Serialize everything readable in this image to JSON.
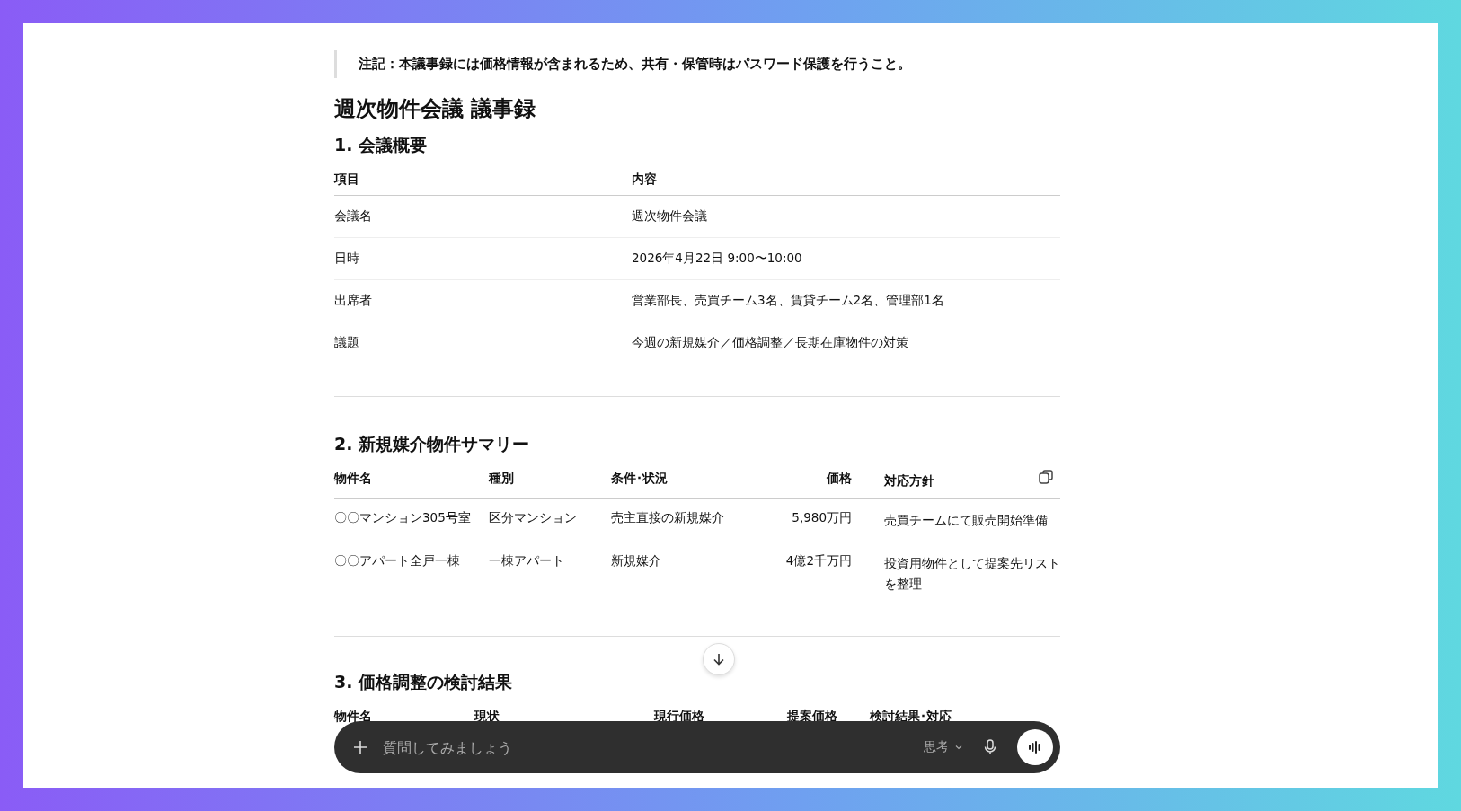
{
  "note": "注記：本議事録には価格情報が含まれるため、共有・保管時はパスワード保護を行うこと。",
  "title": "週次物件会議 議事録",
  "overview": {
    "heading": "1. 会議概要",
    "columns": [
      "項目",
      "内容"
    ],
    "rows": [
      [
        "会議名",
        "週次物件会議"
      ],
      [
        "日時",
        "2026年4月22日 9:00〜10:00"
      ],
      [
        "出席者",
        "営業部長、売買チーム3名、賃貸チーム2名、管理部1名"
      ],
      [
        "議題",
        "今週の新規媒介／価格調整／長期在庫物件の対策"
      ]
    ]
  },
  "summary": {
    "heading": "2. 新規媒介物件サマリー",
    "columns": [
      "物件名",
      "種別",
      "条件･状況",
      "価格",
      "対応方針"
    ],
    "rows": [
      [
        "〇〇マンション305号室",
        "区分マンション",
        "売主直接の新規媒介",
        "5,980万円",
        "売買チームにて販売開始準備"
      ],
      [
        "〇〇アパート全戸一棟",
        "一棟アパート",
        "新規媒介",
        "4億2千万円",
        "投資用物件として提案先リストを整理"
      ]
    ]
  },
  "price_review": {
    "heading": "3. 価格調整の検討結果",
    "columns": [
      "物件名",
      "現状",
      "現行価格",
      "提案価格",
      "検討結果･対応"
    ]
  },
  "composer": {
    "placeholder": "質問してみましょう",
    "mode": "思考"
  }
}
